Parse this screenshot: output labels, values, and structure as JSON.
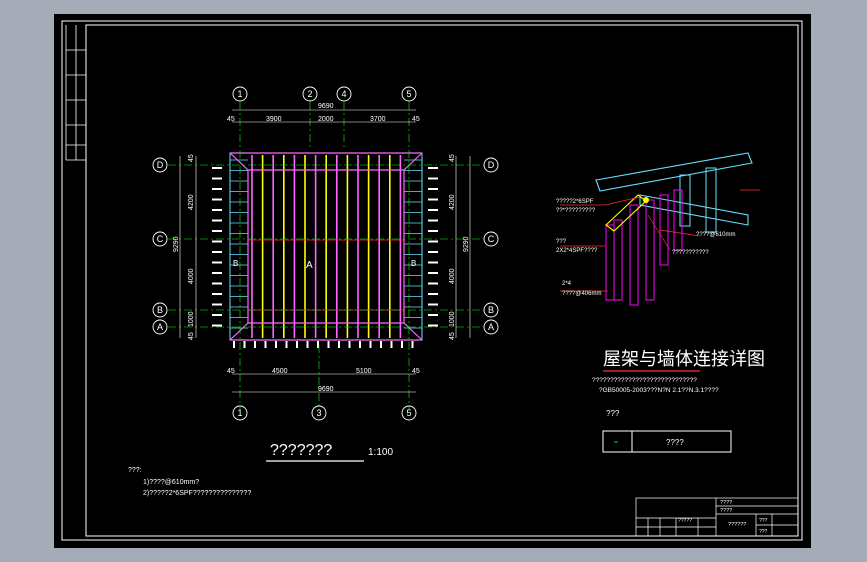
{
  "colors": {
    "background": "#a6acb7",
    "canvas": "#000000",
    "line": "#ffffff",
    "dim": "#7cff7c",
    "axis": "#00ff00",
    "rafter": "#ffff00",
    "purlin": "#ff66ff",
    "edge": "#66e0ff",
    "wall": "#ff00ff",
    "red": "#ff3030"
  },
  "plan": {
    "top_axes": [
      "1",
      "2",
      "4",
      "5"
    ],
    "bottom_axes": [
      "1",
      "3",
      "5"
    ],
    "side_axes": [
      "D",
      "C",
      "B",
      "A"
    ],
    "top_total": "9690",
    "top_segments": [
      "45",
      "3900",
      "2000",
      "3700",
      "45"
    ],
    "bottom_total": "9690",
    "bottom_segments": [
      "45",
      "4500",
      "5100",
      "45"
    ],
    "side_total": "9290",
    "side_segments": [
      "45",
      "4200",
      "4000",
      "1000",
      "45"
    ],
    "zone_center": "A",
    "zone_left": "B",
    "zone_right": "B",
    "title": "???????",
    "scale": "1:100"
  },
  "notes": {
    "heading": "???:",
    "line1": "1)????@610mm?",
    "line2": "2)?????2*6SPF???????????????"
  },
  "detail": {
    "label1a": "?????2*6SPF",
    "label1b": "??*?????????",
    "label2": "????@610mm",
    "label3a": "???",
    "label3b": "2X2*4SPF????",
    "label4": "???????????",
    "label5a": "2*4",
    "label5b": "????@406mm",
    "title": "屋架与墙体连接详图",
    "ref1": "?????????????????????????????",
    "ref2": "?GB50005-2003???N?N 2.1??N.3.1????",
    "legend_heading": "???",
    "legend_symbol": "-",
    "legend_label": "????"
  },
  "title_block": {
    "r1": "????",
    "r2": "????",
    "name": "?????",
    "code": "??????",
    "c1": "???",
    "c2": "???"
  }
}
